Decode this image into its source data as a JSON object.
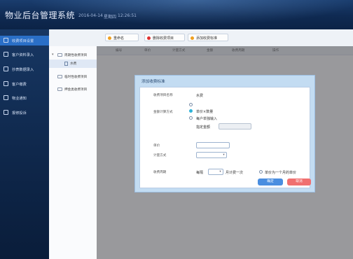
{
  "app": {
    "title": "物业后台管理系统",
    "date": "2016-04-14",
    "weekday": "星期四",
    "time": "12:26:51"
  },
  "sidebar": {
    "items": [
      {
        "label": "收费项目设置",
        "active": true
      },
      {
        "label": "客户资料录入",
        "active": false
      },
      {
        "label": "抄表数据录入",
        "active": false
      },
      {
        "label": "客户缴费",
        "active": false
      },
      {
        "label": "物业通知",
        "active": false
      },
      {
        "label": "报修投诉",
        "active": false
      }
    ]
  },
  "toolbar": {
    "buttons": [
      {
        "label": "重命名",
        "color": "#f0a020"
      },
      {
        "label": "删除收费项目",
        "color": "#e03030"
      },
      {
        "label": "添加收费标准",
        "color": "#f0a020"
      }
    ]
  },
  "tree": {
    "nodes": [
      {
        "label": "周期性收费项目"
      },
      {
        "label": "水费"
      },
      {
        "label": "临时性收费项目"
      },
      {
        "label": "押金类收费项目"
      }
    ]
  },
  "grid": {
    "columns": [
      "编号",
      "单价",
      "计量方式",
      "金额",
      "收费周期",
      "操作"
    ]
  },
  "modal": {
    "title": "添加收费标准",
    "item_name_label": "收费项目名称",
    "item_name_value": "水费",
    "calc_label": "金额计算方式",
    "opt_price_qty": "单价×数量",
    "opt_custom": "每户单独输入",
    "fixed_amount_label": "指定金额",
    "unit_price_label": "单价",
    "measure_label": "计量方式",
    "cycle_label": "收费周期",
    "cycle_each": "每隔",
    "cycle_suffix": "月计费一次",
    "cycle_price_opt": "单价为一个月的单价",
    "ok": "确定",
    "cancel": "取消"
  },
  "colors": {
    "accent": "#2a6fc7",
    "ok": "#4a8ee0",
    "cancel": "#f07070",
    "radio_on": "#2fb3d8"
  }
}
